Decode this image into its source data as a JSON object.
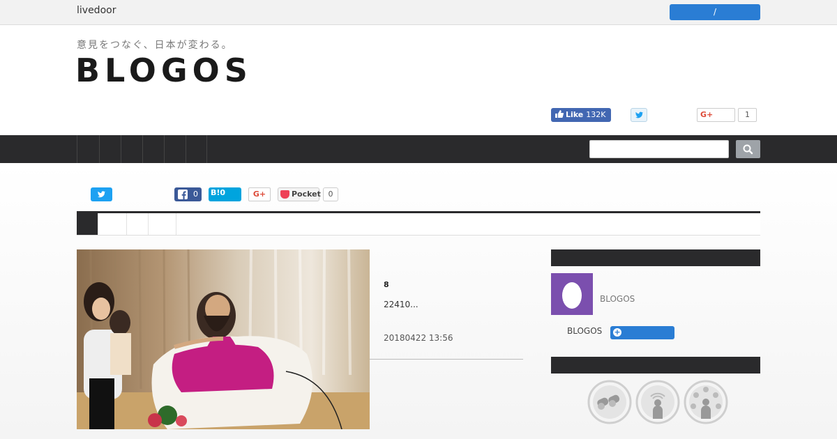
{
  "topbar": {
    "brand": "livedoor",
    "login_label": "/"
  },
  "header": {
    "tagline": "意見をつなぐ、日本が変わる。",
    "logo": "BLOGOS",
    "fb_like": {
      "label": "Like",
      "count": "132K"
    },
    "gplus": {
      "label": "G+",
      "count": "1"
    }
  },
  "nav": {
    "items": [
      "",
      "",
      "",
      "",
      "",
      ""
    ]
  },
  "share": {
    "facebook_count": "0",
    "hatena": {
      "label": "B!",
      "count": "0"
    },
    "gplus_label": "G+",
    "pocket": {
      "label": "Pocket",
      "count": "0"
    }
  },
  "article": {
    "rank": "8",
    "text": "22410...",
    "date": "20180422 13:56"
  },
  "sidebar": {
    "author_name": "BLOGOS",
    "follow_label": "BLOGOS",
    "follow_button": "+"
  },
  "colors": {
    "navbar": "#2a2a2c",
    "accent_blue": "#2a7dd4",
    "avatar_purple": "#7b4fae",
    "facebook": "#4267b2",
    "twitter": "#1da1f2",
    "hatena": "#00a4de",
    "pocket": "#ee4056"
  },
  "icons": [
    "twitter-icon",
    "facebook-icon",
    "search-icon",
    "pocket-icon",
    "egg-avatar-icon",
    "binoculars-icon",
    "person-signal-icon",
    "person-social-icon"
  ]
}
